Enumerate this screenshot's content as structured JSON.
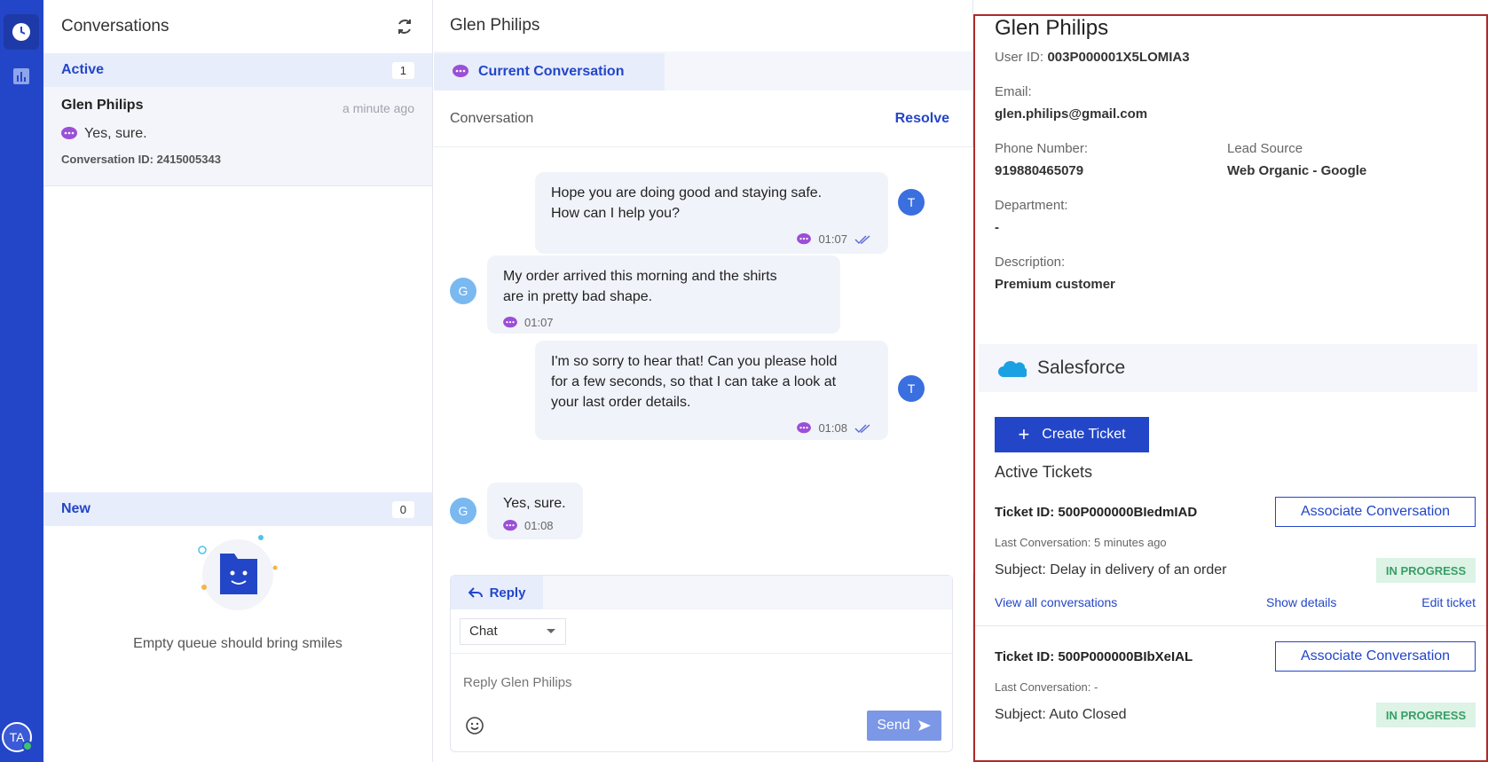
{
  "nav": {
    "user_initials": "TA"
  },
  "conversations": {
    "title": "Conversations",
    "active": {
      "label": "Active",
      "count": "1"
    },
    "item": {
      "name": "Glen Philips",
      "time": "a minute ago",
      "last_message": "Yes, sure.",
      "conversation_id": "Conversation ID: 2415005343"
    },
    "new": {
      "label": "New",
      "count": "0"
    },
    "empty_text": "Empty queue should bring smiles"
  },
  "chat": {
    "contact_name": "Glen Philips",
    "tab_label": "Current Conversation",
    "conversation_label": "Conversation",
    "resolve_label": "Resolve",
    "messages": [
      {
        "from": "T",
        "text_lines": [
          "Hope you are doing good and staying safe.",
          "How can I help you?"
        ],
        "time": "01:07"
      },
      {
        "from": "G",
        "text_lines": [
          "My order arrived this morning and the shirts",
          "are in pretty bad shape."
        ],
        "time": "01:07"
      },
      {
        "from": "T",
        "text_lines": [
          "I'm so sorry to hear that! Can you please hold",
          "for a few seconds, so that I can take a look at",
          "your last order details."
        ],
        "time": "01:08"
      },
      {
        "from": "G",
        "text_lines": [
          "Yes, sure."
        ],
        "time": "01:08"
      }
    ],
    "reply": {
      "tab_label": "Reply",
      "channel": "Chat",
      "placeholder": "Reply Glen Philips",
      "send_label": "Send"
    }
  },
  "profile": {
    "name": "Glen Philips",
    "user_id_label": "User ID:",
    "user_id": "003P000001X5LOMIA3",
    "email_label": "Email:",
    "email": "glen.philips@gmail.com",
    "phone_label": "Phone Number:",
    "phone": "919880465079",
    "lead_source_label": "Lead Source",
    "lead_source": "Web Organic - Google",
    "department_label": "Department:",
    "department": "-",
    "description_label": "Description:",
    "description": "Premium customer",
    "salesforce_label": "Salesforce",
    "create_ticket_label": "Create Ticket",
    "active_tickets_label": "Active Tickets",
    "tickets": [
      {
        "id": "Ticket ID: 500P000000BIedmIAD",
        "last_conversation": "Last Conversation: 5 minutes ago",
        "subject": "Subject: Delay in delivery of an order",
        "status": "IN PROGRESS",
        "associate_label": "Associate Conversation",
        "view_all": "View all conversations",
        "show_details": "Show details",
        "edit": "Edit ticket"
      },
      {
        "id": "Ticket ID: 500P000000BIbXeIAL",
        "last_conversation": "Last Conversation: -",
        "subject": "Subject: Auto Closed",
        "status": "IN PROGRESS",
        "associate_label": "Associate Conversation"
      }
    ]
  },
  "colors": {
    "brand": "#2346c8",
    "highlight_border": "#b02a2a",
    "status_green": "#3a9e66"
  }
}
